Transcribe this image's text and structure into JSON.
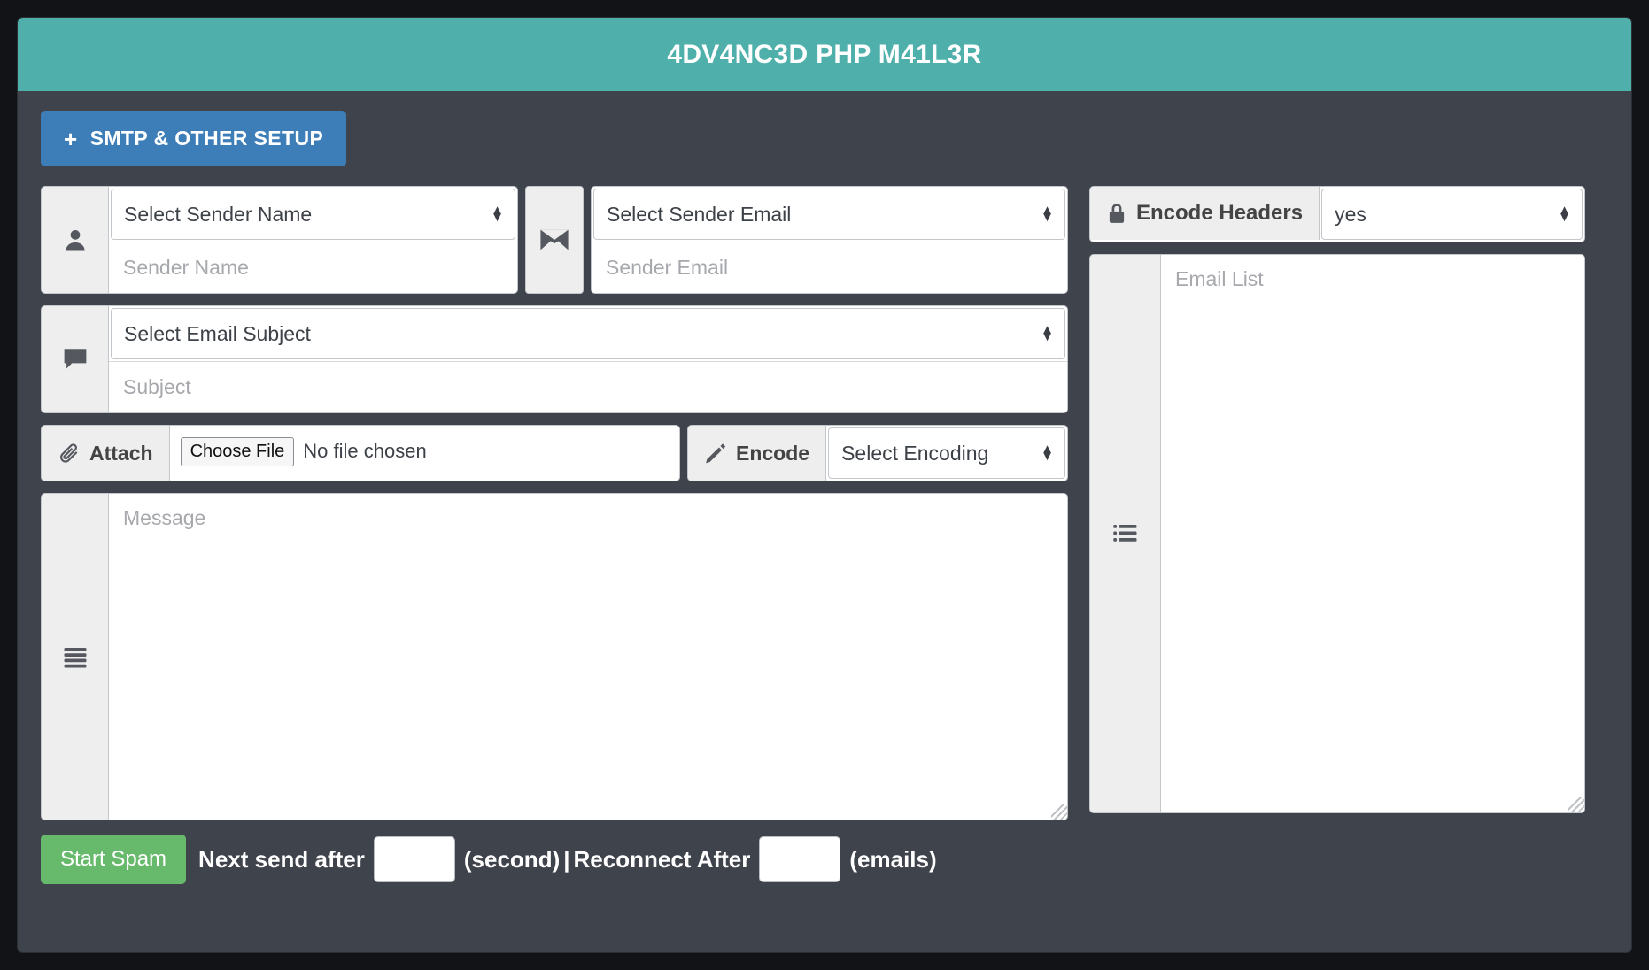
{
  "window": {
    "title": "4DV4NC3D PHP M41L3R",
    "header_color": "#4fb0ab",
    "body_color": "#3f434c"
  },
  "toolbar": {
    "setup_button": "SMTP & OTHER SETUP",
    "setup_plus": "+",
    "setup_color": "#3e7eb8"
  },
  "sender": {
    "person_icon": "user-icon",
    "envelope_icon": "envelope-icon",
    "name_select": "Select Sender Name",
    "name_placeholder": "Sender Name",
    "name_value": "",
    "email_select": "Select Sender Email",
    "email_placeholder": "Sender Email",
    "email_value": ""
  },
  "subject": {
    "comment_icon": "comment-icon",
    "select": "Select Email Subject",
    "placeholder": "Subject",
    "value": ""
  },
  "attach": {
    "label": "Attach",
    "paperclip_icon": "paperclip-icon",
    "choose_file": "Choose File",
    "file_status": "No file chosen",
    "encode_label": "Encode",
    "pencil_icon": "pencil-icon",
    "encoding_select": "Select Encoding"
  },
  "message": {
    "align_icon": "align-justify-icon",
    "placeholder": "Message",
    "value": ""
  },
  "encode_headers": {
    "lock_icon": "lock-icon",
    "label": "Encode Headers",
    "value": "yes"
  },
  "email_list": {
    "list_icon": "list-icon",
    "placeholder": "Email List",
    "value": ""
  },
  "bottom": {
    "start_button": "Start Spam",
    "start_color": "#67b96c",
    "next_send_label": "Next send after",
    "next_send_value": "",
    "second_label": "(second)",
    "separator": "|",
    "reconnect_label": "Reconnect After",
    "reconnect_value": "",
    "emails_label": "(emails)"
  }
}
